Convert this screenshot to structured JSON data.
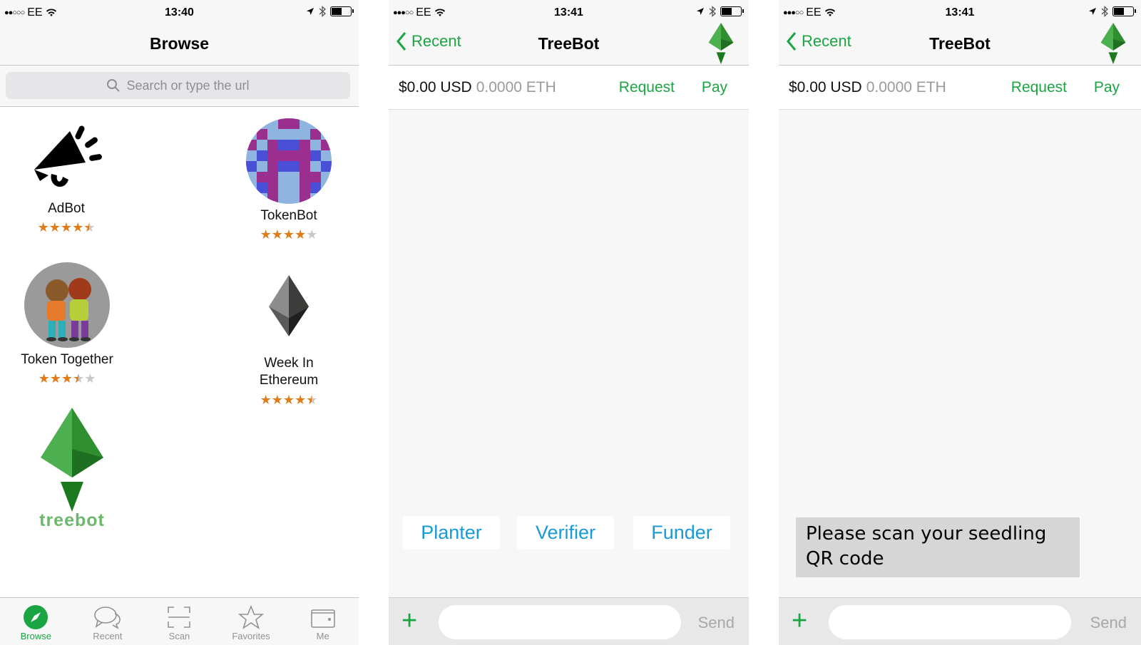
{
  "screen1": {
    "status": {
      "carrier": "EE",
      "time": "13:40"
    },
    "title": "Browse",
    "search": {
      "placeholder": "Search or type the url"
    },
    "apps": [
      {
        "name": "AdBot",
        "rating": 4.5
      },
      {
        "name": "TokenBot",
        "rating": 4
      },
      {
        "name": "Token Together",
        "rating": 3.5
      },
      {
        "name": "Week In Ethereum",
        "line1": "Week In",
        "line2": "Ethereum",
        "rating": 4.5
      }
    ],
    "treebot_logo_text": "treebot",
    "tabs": [
      {
        "label": "Browse",
        "icon": "compass-icon",
        "active": true
      },
      {
        "label": "Recent",
        "icon": "chat-bubbles-icon",
        "active": false
      },
      {
        "label": "Scan",
        "icon": "scan-frame-icon",
        "active": false
      },
      {
        "label": "Favorites",
        "icon": "star-icon",
        "active": false
      },
      {
        "label": "Me",
        "icon": "wallet-icon",
        "active": false
      }
    ]
  },
  "screen2": {
    "status": {
      "carrier": "EE",
      "time": "13:41"
    },
    "back_label": "Recent",
    "title": "TreeBot",
    "balance": {
      "usd": "$0.00 USD",
      "eth": "0.0000 ETH"
    },
    "request_label": "Request",
    "pay_label": "Pay",
    "options": [
      "Planter",
      "Verifier",
      "Funder"
    ],
    "send_label": "Send"
  },
  "screen3": {
    "status": {
      "carrier": "EE",
      "time": "13:41"
    },
    "back_label": "Recent",
    "title": "TreeBot",
    "balance": {
      "usd": "$0.00 USD",
      "eth": "0.0000 ETH"
    },
    "request_label": "Request",
    "pay_label": "Pay",
    "message": "Please scan your seedling QR code",
    "send_label": "Send"
  },
  "colors": {
    "accent_green": "#1ba542",
    "option_blue": "#1a9ad6",
    "star_orange": "#e07b1a",
    "tab_gray": "#929292"
  }
}
